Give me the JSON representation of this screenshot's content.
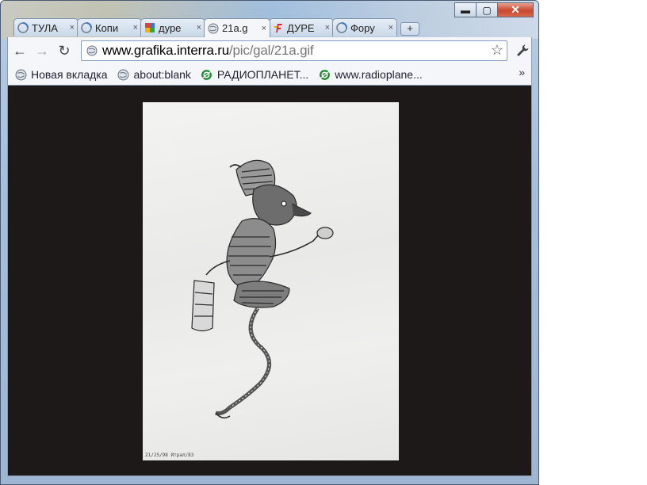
{
  "window": {
    "controls": {
      "minimize": "▬",
      "maximize": "▢",
      "close": "✕"
    }
  },
  "tabs": [
    {
      "label": "ТУЛА",
      "icon": "globe-spinner-icon",
      "close": "×"
    },
    {
      "label": "Копи",
      "icon": "globe-spinner-icon",
      "close": "×"
    },
    {
      "label": "дуре",
      "icon": "google-icon",
      "close": "×"
    },
    {
      "label": "21a.g",
      "icon": "globe-icon",
      "close": "×",
      "active": true
    },
    {
      "label": "ДУРЕ",
      "icon": "f-logo-icon",
      "close": "×"
    },
    {
      "label": "Фору",
      "icon": "globe-spinner-icon",
      "close": "×"
    }
  ],
  "new_tab": "+",
  "toolbar": {
    "back": "←",
    "forward": "→",
    "reload": "↻",
    "url_host": "www.grafika.interra.ru",
    "url_path": "/pic/gal/21a.gif",
    "star": "☆",
    "wrench": "🔧"
  },
  "bookmarks": [
    {
      "label": "Новая вкладка",
      "icon": "globe-icon"
    },
    {
      "label": "about:blank",
      "icon": "globe-icon"
    },
    {
      "label": "РАДИОПЛАНЕТ...",
      "icon": "radioplanet-icon"
    },
    {
      "label": "www.radioplane...",
      "icon": "radioplanet-icon"
    }
  ],
  "bookmarks_overflow": "»",
  "image": {
    "subject": "pen-drawing-creature",
    "caption": "21/25/98 Итрал/83"
  },
  "colors": {
    "content_bg": "#1c1918",
    "close_button": "#c8462c",
    "link_text": "#223355"
  }
}
